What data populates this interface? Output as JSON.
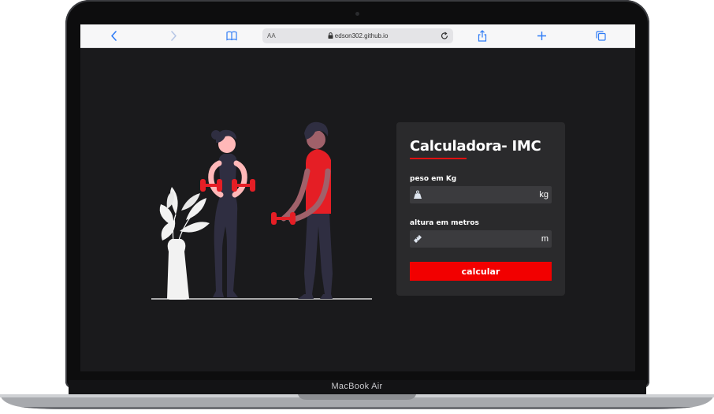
{
  "browser": {
    "reader_label": "AA",
    "url": "edson302.github.io",
    "icons": {
      "back": "chevron-left-icon",
      "forward": "chevron-right-icon",
      "bookmarks": "book-icon",
      "lock": "lock-icon",
      "reload": "reload-icon",
      "share": "share-icon",
      "new_tab": "plus-icon",
      "tabs": "tabs-icon"
    }
  },
  "laptop": {
    "brand": "MacBook Air"
  },
  "form": {
    "title": "Calculadora- IMC",
    "weight_label": "peso em Kg",
    "weight_unit": "kg",
    "weight_value": "",
    "height_label": "altura em metros",
    "height_unit": "m",
    "height_value": "",
    "submit_label": "calcular"
  },
  "colors": {
    "accent": "#f20000",
    "background": "#1a1a1c",
    "card": "#2a2a2c",
    "field": "#3b3b3e",
    "browser_blue": "#2f7cf6"
  }
}
